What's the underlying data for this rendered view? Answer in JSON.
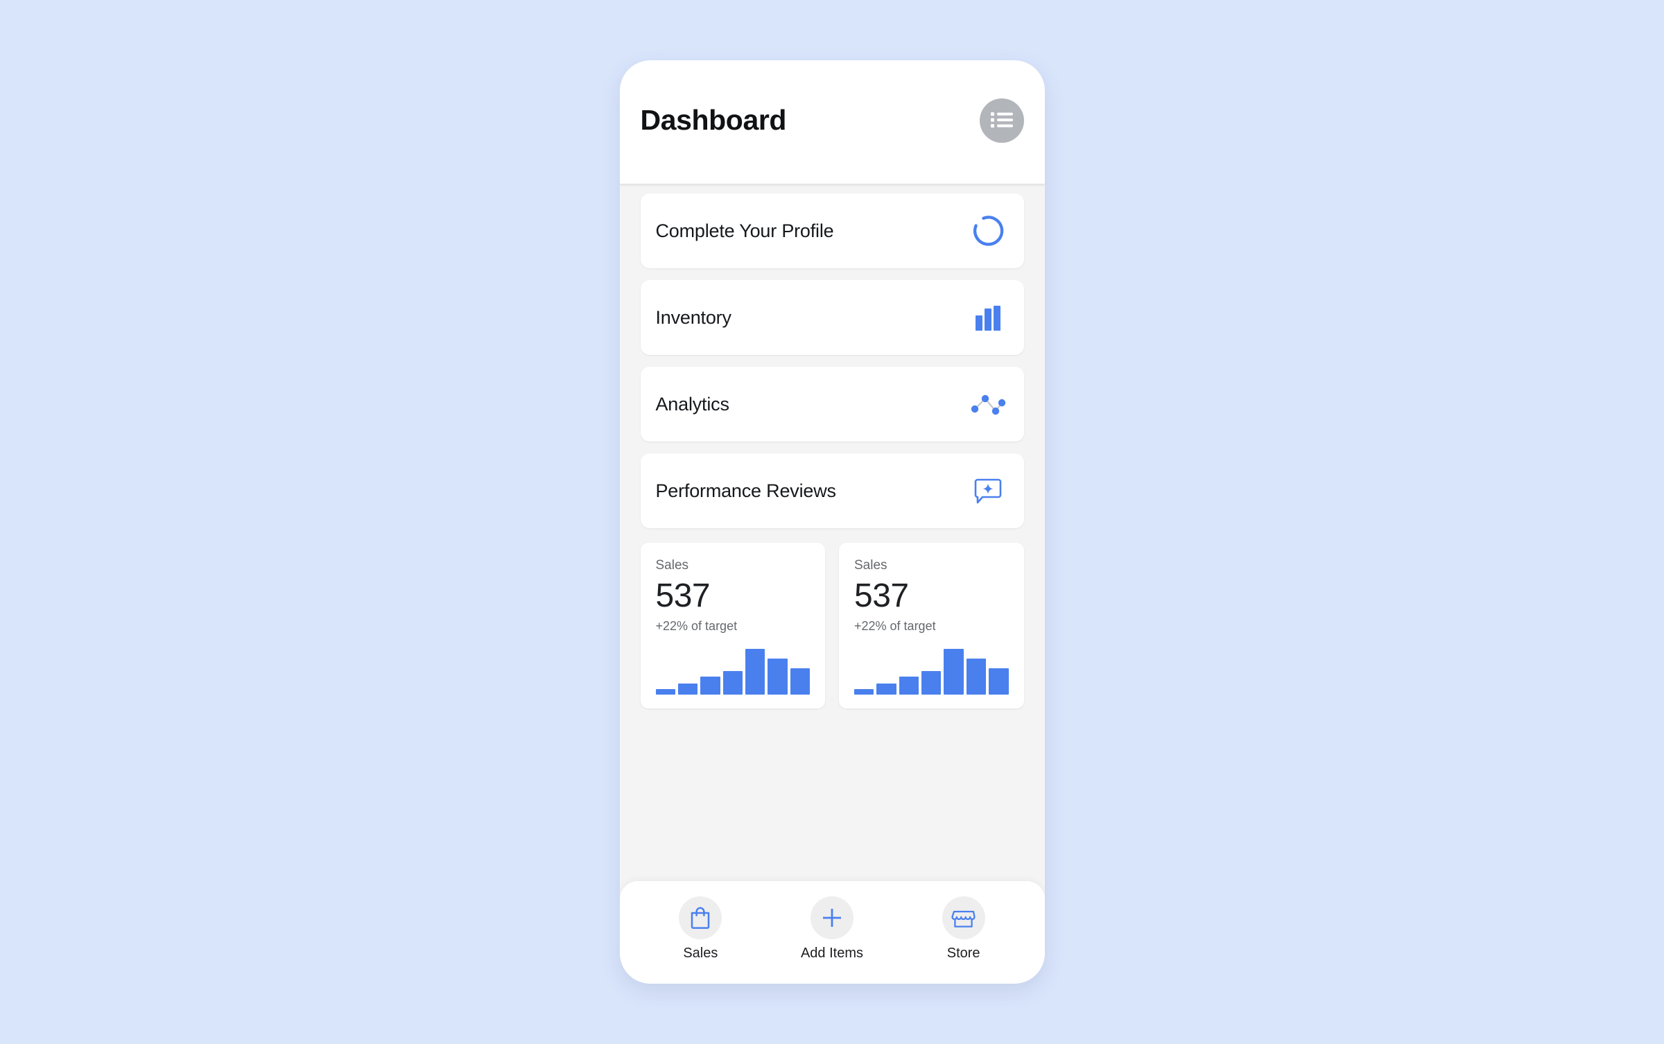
{
  "theme": {
    "page_background": "#d9e5fb",
    "accent_blue": "#4a80ee",
    "surface_white": "#ffffff",
    "app_background": "#f4f4f4",
    "muted_text": "#65686d",
    "menu_circle_gray": "#b2b5ba",
    "nav_circle_gray": "#eeeeee"
  },
  "header": {
    "title": "Dashboard",
    "menu_icon": "list-icon"
  },
  "features": [
    {
      "label": "Complete Your Profile",
      "icon": "progress-spinner-icon"
    },
    {
      "label": "Inventory",
      "icon": "bar-chart-icon"
    },
    {
      "label": "Analytics",
      "icon": "line-chart-icon"
    },
    {
      "label": "Performance Reviews",
      "icon": "chat-sparkle-icon"
    }
  ],
  "stats": [
    {
      "label": "Sales",
      "value": "537",
      "sub": "+22% of target"
    },
    {
      "label": "Sales",
      "value": "537",
      "sub": "+22% of target"
    }
  ],
  "chart_data": [
    {
      "type": "bar",
      "title": "Sales",
      "categories": [
        "1",
        "2",
        "3",
        "4",
        "5",
        "6",
        "7"
      ],
      "values": [
        12,
        25,
        40,
        52,
        100,
        80,
        58
      ],
      "ylim": [
        0,
        100
      ],
      "xlabel": "",
      "ylabel": "",
      "grid": false,
      "legend": "none",
      "color": "#4a80ee"
    },
    {
      "type": "bar",
      "title": "Sales",
      "categories": [
        "1",
        "2",
        "3",
        "4",
        "5",
        "6",
        "7"
      ],
      "values": [
        12,
        25,
        40,
        52,
        100,
        80,
        58
      ],
      "ylim": [
        0,
        100
      ],
      "xlabel": "",
      "ylabel": "",
      "grid": false,
      "legend": "none",
      "color": "#4a80ee"
    }
  ],
  "bottom_nav": [
    {
      "label": "Sales",
      "icon": "shopping-bag-icon"
    },
    {
      "label": "Add Items",
      "icon": "plus-icon"
    },
    {
      "label": "Store",
      "icon": "storefront-icon"
    }
  ]
}
